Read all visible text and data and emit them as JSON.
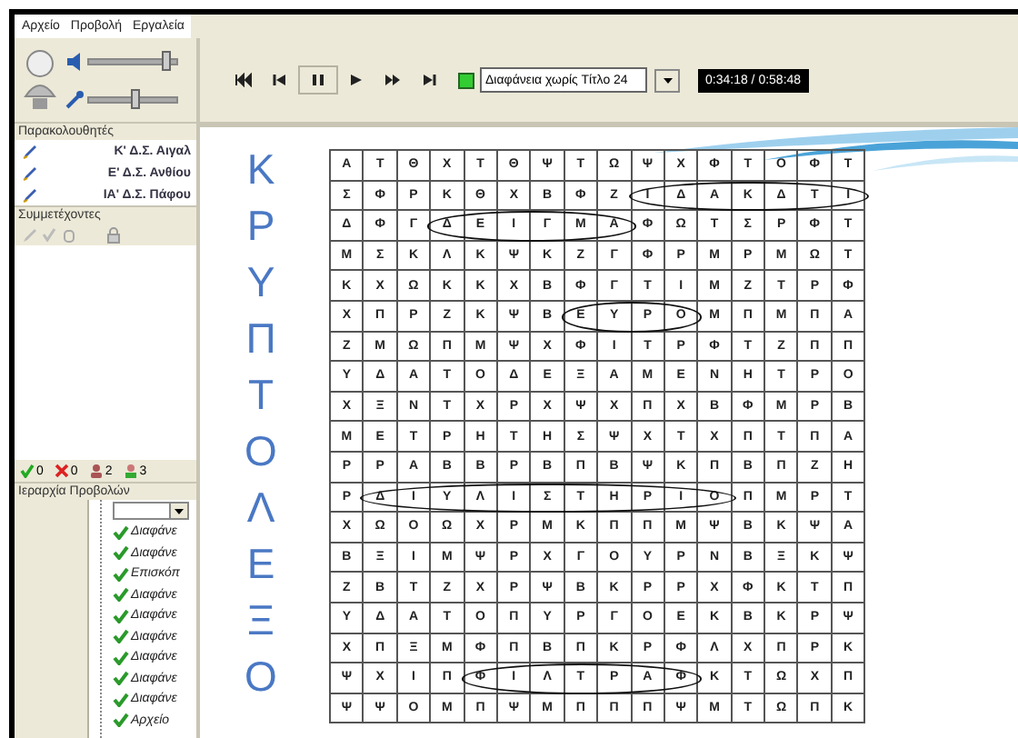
{
  "menu": [
    "Αρχείο",
    "Προβολή",
    "Εργαλεία"
  ],
  "audio": {
    "speaker_volume": {
      "level": 0.9
    },
    "mic_volume": {
      "level": 0.55
    }
  },
  "observers": {
    "title": "Παρακολουθητές",
    "items": [
      "Κ' Δ.Σ. Αιγαλ",
      "Ε' Δ.Σ. Ανθίου",
      "ΙΑ' Δ.Σ. Πάφου"
    ]
  },
  "participants": {
    "title": "Συμμετέχοντες"
  },
  "counts": [
    {
      "kind": "yes",
      "value": "0"
    },
    {
      "kind": "no",
      "value": "0"
    },
    {
      "kind": "raised",
      "value": "2"
    },
    {
      "kind": "present",
      "value": "3"
    }
  ],
  "slide_tree": {
    "title": "Ιεραρχία Προβολών",
    "items": [
      {
        "label": "Διαφάνε",
        "checked": true
      },
      {
        "label": "Διαφάνε",
        "checked": true
      },
      {
        "label": "Επισκόπ",
        "checked": true
      },
      {
        "label": "Διαφάνε",
        "checked": true
      },
      {
        "label": "Διαφάνε",
        "checked": true
      },
      {
        "label": "Διαφάνε",
        "checked": true
      },
      {
        "label": "Διαφάνε",
        "checked": true
      },
      {
        "label": "Διαφάνε",
        "checked": true
      },
      {
        "label": "Διαφάνε",
        "checked": true
      },
      {
        "label": "Αρχείο",
        "checked": true
      }
    ]
  },
  "player": {
    "slide": "Διαφάνεια χωρίς Τίτλο 24",
    "time": "0:34:18 / 0:58:48"
  },
  "puzzle": {
    "title": "ΚΡΥΠΤΟΛΕΞΟ",
    "rows": [
      {
        "segments": [
          {
            "letters": [
              "Α",
              "Τ",
              "Θ",
              "Χ",
              "Τ",
              "Θ",
              "Ψ",
              "Τ",
              "Ω",
              "Ψ",
              "Χ",
              "Φ",
              "Τ",
              "Ο",
              "Φ",
              "Τ"
            ],
            "circled": false
          }
        ]
      },
      {
        "segments": [
          {
            "letters": [
              "Σ",
              "Φ",
              "Ρ",
              "Κ",
              "Θ",
              "Χ",
              "Β",
              "Φ",
              "Ζ"
            ],
            "circled": false
          },
          {
            "letters": [
              "Ι",
              "Δ",
              "Α",
              "Κ",
              "Δ",
              "Τ",
              "Ι"
            ],
            "circled": true
          }
        ]
      },
      {
        "segments": [
          {
            "letters": [
              "Δ",
              "Φ",
              "Γ"
            ],
            "circled": false
          },
          {
            "letters": [
              "Δ",
              "Ε",
              "Ι",
              "Γ",
              "Μ",
              "Α"
            ],
            "circled": true
          },
          {
            "letters": [
              "Φ",
              "Ω",
              "Τ",
              "Σ",
              "Ρ",
              "Φ",
              "Τ"
            ],
            "circled": false
          }
        ]
      },
      {
        "segments": [
          {
            "letters": [
              "Μ",
              "Σ",
              "Κ",
              "Λ",
              "Κ",
              "Ψ",
              "Κ",
              "Ζ",
              "Γ",
              "Φ",
              "Ρ",
              "Μ",
              "Ρ",
              "Μ",
              "Ω",
              "Τ"
            ],
            "circled": false
          }
        ]
      },
      {
        "segments": [
          {
            "letters": [
              "Κ",
              "Χ",
              "Ω",
              "Κ",
              "Κ",
              "Χ",
              "Β",
              "Φ",
              "Γ",
              "Τ",
              "Ι",
              "Μ",
              "Ζ",
              "Τ",
              "Ρ",
              "Φ"
            ],
            "circled": false
          }
        ]
      },
      {
        "segments": [
          {
            "letters": [
              "Χ",
              "Π",
              "Ρ",
              "Ζ",
              "Κ",
              "Ψ",
              "Β"
            ],
            "circled": false
          },
          {
            "letters": [
              "Ε",
              "Υ",
              "Ρ",
              "Ο"
            ],
            "circled": true
          },
          {
            "letters": [
              "Μ",
              "Π",
              "Μ",
              "Π",
              "Α"
            ],
            "circled": false
          }
        ]
      },
      {
        "segments": [
          {
            "letters": [
              "Ζ",
              "Μ",
              "Ω",
              "Π",
              "Μ",
              "Ψ",
              "Χ",
              "Φ",
              "Ι",
              "Τ",
              "Ρ",
              "Φ",
              "Τ",
              "Ζ",
              "Π",
              "Π"
            ],
            "circled": false
          }
        ]
      },
      {
        "segments": [
          {
            "letters": [
              "Υ",
              "Δ",
              "Α",
              "Τ",
              "Ο",
              "Δ",
              "Ε",
              "Ξ",
              "Α",
              "Μ",
              "Ε",
              "Ν",
              "Η",
              "Τ",
              "Ρ",
              "Ο"
            ],
            "circled": false
          }
        ]
      },
      {
        "segments": [
          {
            "letters": [
              "Χ",
              "Ξ",
              "Ν",
              "Τ",
              "Χ",
              "Ρ",
              "Χ",
              "Ψ",
              "Χ",
              "Π",
              "Χ",
              "Β",
              "Φ",
              "Μ",
              "Ρ",
              "Β"
            ],
            "circled": false
          }
        ]
      },
      {
        "segments": [
          {
            "letters": [
              "Μ",
              "Ε",
              "Τ",
              "Ρ",
              "Η",
              "Τ",
              "Η",
              "Σ",
              "Ψ",
              "Χ",
              "Τ",
              "Χ",
              "Π",
              "Τ",
              "Π",
              "Α"
            ],
            "circled": false
          }
        ]
      },
      {
        "segments": [
          {
            "letters": [
              "Ρ",
              "Ρ",
              "Α",
              "Β",
              "Β",
              "Ρ",
              "Β",
              "Π",
              "Β",
              "Ψ",
              "Κ",
              "Π",
              "Β",
              "Π",
              "Ζ",
              "Η"
            ],
            "circled": false
          }
        ]
      },
      {
        "segments": [
          {
            "letters": [
              "Ρ"
            ],
            "circled": false
          },
          {
            "letters": [
              "Δ",
              "Ι",
              "Υ",
              "Λ",
              "Ι",
              "Σ",
              "Τ",
              "Η",
              "Ρ",
              "Ι",
              "Ο"
            ],
            "circled": true
          },
          {
            "letters": [
              "Π",
              "Μ",
              "Ρ",
              "Τ"
            ],
            "circled": false
          }
        ]
      },
      {
        "segments": [
          {
            "letters": [
              "Χ",
              "Ω",
              "Ο",
              "Ω",
              "Χ",
              "Ρ",
              "Μ",
              "Κ",
              "Π",
              "Π",
              "Μ",
              "Ψ",
              "Β",
              "Κ",
              "Ψ",
              "Α"
            ],
            "circled": false
          }
        ]
      },
      {
        "segments": [
          {
            "letters": [
              "Β",
              "Ξ",
              "Ι",
              "Μ",
              "Ψ",
              "Ρ",
              "Χ",
              "Γ",
              "Ο",
              "Υ",
              "Ρ",
              "Ν",
              "Β",
              "Ξ",
              "Κ",
              "Ψ"
            ],
            "circled": false
          }
        ]
      },
      {
        "segments": [
          {
            "letters": [
              "Ζ",
              "Β",
              "Τ",
              "Ζ",
              "Χ",
              "Ρ",
              "Ψ",
              "Β",
              "Κ",
              "Ρ",
              "Ρ",
              "Χ",
              "Φ",
              "Κ",
              "Τ",
              "Π"
            ],
            "circled": false
          }
        ]
      },
      {
        "segments": [
          {
            "letters": [
              "Υ",
              "Δ",
              "Α",
              "Τ",
              "Ο",
              "Π",
              "Υ",
              "Ρ",
              "Γ",
              "Ο",
              "Ε",
              "Κ",
              "Β",
              "Κ",
              "Ρ",
              "Ψ"
            ],
            "circled": false
          }
        ]
      },
      {
        "segments": [
          {
            "letters": [
              "Χ",
              "Π",
              "Ξ",
              "Μ",
              "Φ",
              "Π",
              "Β",
              "Π",
              "Κ",
              "Ρ",
              "Φ",
              "Λ",
              "Χ",
              "Π",
              "Ρ",
              "Κ"
            ],
            "circled": false
          }
        ]
      },
      {
        "segments": [
          {
            "letters": [
              "Ψ",
              "Χ",
              "Ι",
              "Π"
            ],
            "circled": false
          },
          {
            "letters": [
              "Φ",
              "Ι",
              "Λ",
              "Τ",
              "Ρ",
              "Α",
              "Φ"
            ],
            "circled": true
          },
          {
            "letters": [
              "Κ",
              "Τ",
              "Ω",
              "Χ",
              "Π"
            ],
            "circled": false
          }
        ]
      },
      {
        "segments": [
          {
            "letters": [
              "Ψ",
              "Ψ",
              "Ο",
              "Μ",
              "Π",
              "Ψ",
              "Μ",
              "Π",
              "Π",
              "Π",
              "Ψ",
              "Μ",
              "Τ",
              "Ω",
              "Π",
              "Κ"
            ],
            "circled": false
          }
        ]
      }
    ]
  }
}
